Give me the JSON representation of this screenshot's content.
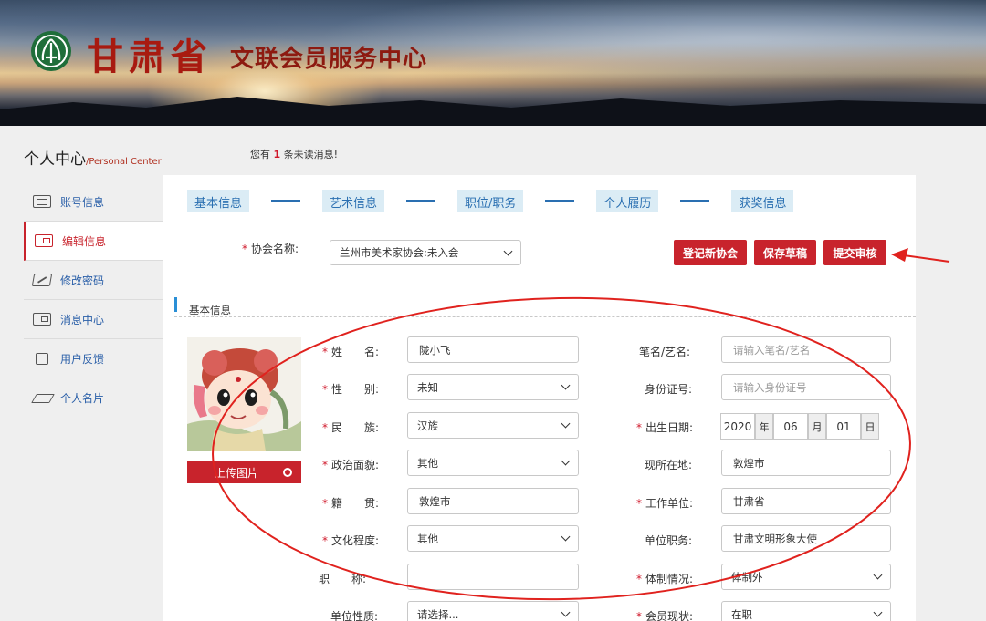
{
  "banner": {
    "title_main": "甘肃省",
    "title_sub": "文联会员服务中心"
  },
  "header": {
    "pc_title": "个人中心",
    "pc_title_en": "/Personal Center",
    "notice_prefix": "您有",
    "notice_count": "1",
    "notice_suffix": "条未读消息!"
  },
  "sidebar": {
    "items": [
      {
        "label": "账号信息",
        "icon": "account-list-icon"
      },
      {
        "label": "编辑信息",
        "icon": "edit-card-icon"
      },
      {
        "label": "修改密码",
        "icon": "pen-icon"
      },
      {
        "label": "消息中心",
        "icon": "message-icon"
      },
      {
        "label": "用户反馈",
        "icon": "feedback-icon"
      },
      {
        "label": "个人名片",
        "icon": "graduation-cap-icon"
      }
    ]
  },
  "steps": [
    "基本信息",
    "艺术信息",
    "职位/职务",
    "个人履历",
    "获奖信息"
  ],
  "association": {
    "required": "*",
    "label": "协会名称:",
    "value": "兰州市美术家协会:未入会"
  },
  "buttons": {
    "register": "登记新协会",
    "draft": "保存草稿",
    "submit": "提交审核"
  },
  "section_title": "基本信息",
  "upload": {
    "label": "上传图片"
  },
  "colors": {
    "brand_red": "#c8232c",
    "step_blue": "#2a6fb1",
    "annotation_red": "#e0221e"
  },
  "form": {
    "name": {
      "label": "姓　　名:",
      "value": "陇小飞"
    },
    "pen_name": {
      "label": "笔名/艺名:",
      "placeholder": "请输入笔名/艺名"
    },
    "gender": {
      "label": "性　　别:",
      "value": "未知"
    },
    "id_card": {
      "label": "身份证号:",
      "placeholder": "请输入身份证号"
    },
    "ethnicity": {
      "label": "民　　族:",
      "value": "汉族"
    },
    "birth": {
      "label": "出生日期:",
      "year": "2020",
      "year_unit": "年",
      "month": "06",
      "month_unit": "月",
      "day": "01",
      "day_unit": "日"
    },
    "political": {
      "label": "政治面貌:",
      "value": "其他"
    },
    "location": {
      "label": "现所在地:",
      "value": "敦煌市"
    },
    "native": {
      "label": "籍　　贯:",
      "value": "敦煌市"
    },
    "employer": {
      "label": "工作单位:",
      "value": "甘肃省"
    },
    "education": {
      "label": "文化程度:",
      "value": "其他"
    },
    "position": {
      "label": "单位职务:",
      "value": "甘肃文明形象大使"
    },
    "title": {
      "label": "职　　称:",
      "value": ""
    },
    "system": {
      "label": "体制情况:",
      "value": "体制外"
    },
    "unit_type": {
      "label": "单位性质:",
      "value": "请选择..."
    },
    "member_status": {
      "label": "会员现状:",
      "value": "在职"
    }
  },
  "required_mark": "*"
}
